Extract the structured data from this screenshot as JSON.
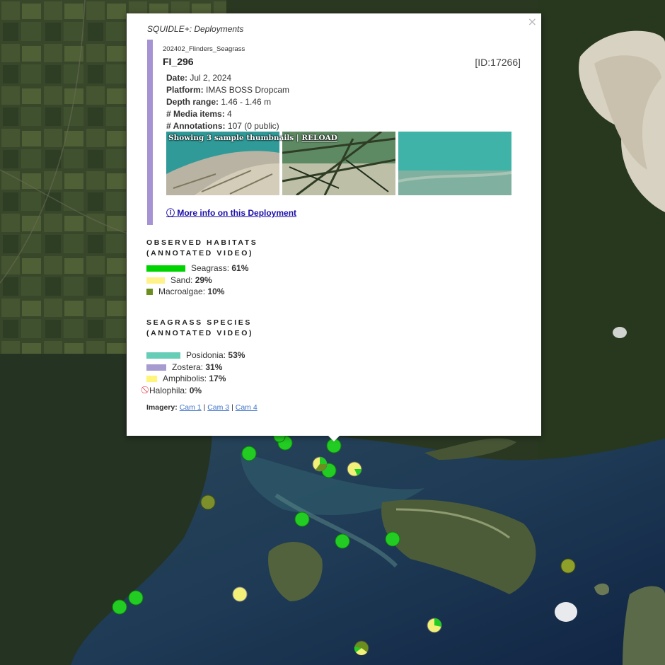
{
  "popup": {
    "source": "SQUIDLE+: Deployments",
    "campaign": "202402_Flinders_Seagrass",
    "deployment": "FI_296",
    "id": "[ID:17266]",
    "fields": [
      {
        "label": "Date:",
        "value": "Jul 2, 2024"
      },
      {
        "label": "Platform:",
        "value": "IMAS BOSS Dropcam"
      },
      {
        "label": "Depth range:",
        "value": "1.46 - 1.46 m"
      },
      {
        "label": "# Media items:",
        "value": "4"
      },
      {
        "label": "# Annotations:",
        "value": "107 (0 public)"
      }
    ],
    "thumbnail_caption": "Showing 3 sample thumbnails |",
    "reload": "RELOAD",
    "more_info": "More info on this Deployment",
    "close": "×"
  },
  "habitats": {
    "title_line1": "OBSERVED HABITATS",
    "title_line2": "(ANNOTATED VIDEO)",
    "items": [
      {
        "name": "Seagrass:",
        "pct": "61%",
        "color": "#00d400",
        "value": 0.61
      },
      {
        "name": "Sand:",
        "pct": "29%",
        "color": "#fff28a",
        "value": 0.29
      },
      {
        "name": "Macroalgae:",
        "pct": "10%",
        "color": "#6b8f1f",
        "value": 0.1
      }
    ]
  },
  "species": {
    "title_line1": "SEAGRASS SPECIES",
    "title_line2": "(ANNOTATED VIDEO)",
    "items": [
      {
        "name": "Posidonia:",
        "pct": "53%",
        "color": "#66cdb6",
        "value": 0.53
      },
      {
        "name": "Zostera:",
        "pct": "31%",
        "color": "#a79cd0",
        "value": 0.31
      },
      {
        "name": "Amphibolis:",
        "pct": "17%",
        "color": "#fff57a",
        "value": 0.17
      },
      {
        "name": "Halophila:",
        "pct": "0%",
        "color": "",
        "value": 0,
        "icon": "not-allowed-icon"
      }
    ]
  },
  "imagery": {
    "label": "Imagery:",
    "links": [
      "Cam 1",
      "Cam 3",
      "Cam 4"
    ],
    "sep": "|"
  }
}
